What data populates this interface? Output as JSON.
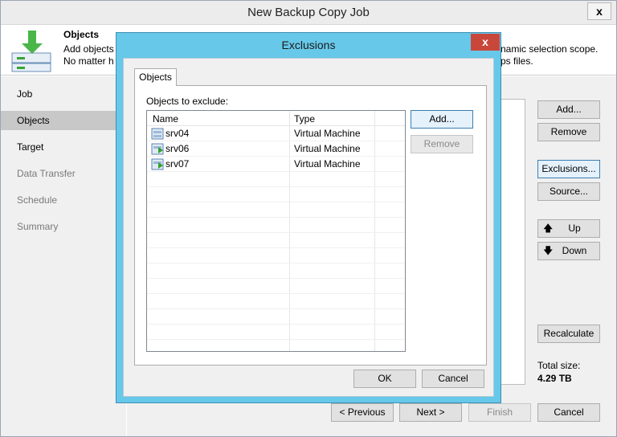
{
  "window": {
    "title": "New Backup Copy Job",
    "close_glyph": "x"
  },
  "header": {
    "title": "Objects",
    "desc_left1": "Add objects",
    "desc_left2": "No matter h",
    "desc_right1": "namic selection scope.",
    "desc_right2": "ps files.",
    "icon": "download-arrow-icon"
  },
  "sidebar": {
    "items": [
      {
        "label": "Job",
        "state": "normal"
      },
      {
        "label": "Objects",
        "state": "active"
      },
      {
        "label": "Target",
        "state": "normal"
      },
      {
        "label": "Data Transfer",
        "state": "disabled"
      },
      {
        "label": "Schedule",
        "state": "disabled"
      },
      {
        "label": "Summary",
        "state": "disabled"
      }
    ]
  },
  "right_buttons": {
    "add": "Add...",
    "remove": "Remove",
    "exclusions": "Exclusions...",
    "source": "Source...",
    "up": "Up",
    "down": "Down",
    "recalculate": "Recalculate"
  },
  "total": {
    "label": "Total size:",
    "value": "4.29 TB"
  },
  "footer": {
    "previous": "< Previous",
    "next": "Next >",
    "finish": "Finish",
    "cancel": "Cancel"
  },
  "dialog": {
    "title": "Exclusions",
    "close_glyph": "x",
    "tab": "Objects",
    "objects_label": "Objects to exclude:",
    "columns": {
      "name": "Name",
      "type": "Type"
    },
    "rows": [
      {
        "name": "srv04",
        "type": "Virtual Machine",
        "icon": "vm-icon"
      },
      {
        "name": "srv06",
        "type": "Virtual Machine",
        "icon": "vm-running-icon"
      },
      {
        "name": "srv07",
        "type": "Virtual Machine",
        "icon": "vm-running-icon"
      }
    ],
    "add": "Add...",
    "remove": "Remove",
    "ok": "OK",
    "cancel": "Cancel"
  }
}
